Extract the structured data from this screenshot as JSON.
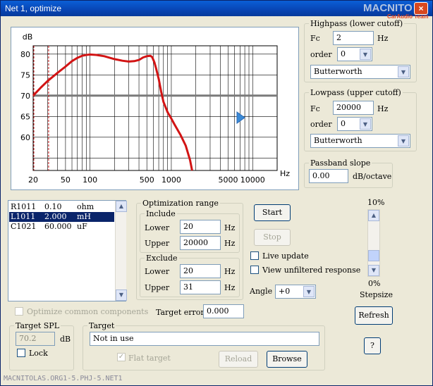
{
  "window": {
    "title": "Net 1, optimize",
    "close_symbol": "×",
    "watermark_brand": "MACNITO",
    "watermark_team": "CarAudio Team"
  },
  "chart_data": {
    "type": "line",
    "ylabel": "dB",
    "xlabel": "Hz",
    "x_scale": "log",
    "xlim": [
      20,
      20000
    ],
    "ylim": [
      52,
      82
    ],
    "y_ticks": [
      80,
      75,
      70,
      65,
      60
    ],
    "x_tick_labels": [
      {
        "v": 20,
        "t": "20"
      },
      {
        "v": 50,
        "t": "50"
      },
      {
        "v": 100,
        "t": "100"
      },
      {
        "v": 500,
        "t": "500"
      },
      {
        "v": 1000,
        "t": "1000"
      },
      {
        "v": 5000,
        "t": "5000"
      },
      {
        "v": 10000,
        "t": "10000"
      }
    ],
    "target_level_db": 70,
    "highpass_marker_hz": 20,
    "lowpass_marker_hz": 31,
    "series": [
      {
        "color": "#d21414",
        "x": [
          20,
          25,
          30,
          40,
          50,
          60,
          70,
          80,
          90,
          100,
          120,
          150,
          200,
          250,
          300,
          350,
          400,
          450,
          500,
          550,
          580,
          620,
          650,
          700,
          750,
          800,
          900,
          1000,
          1100,
          1300,
          1500,
          1700,
          1800
        ],
        "y": [
          70,
          72,
          73.5,
          75.5,
          77,
          78.3,
          79.1,
          79.6,
          79.8,
          79.9,
          79.8,
          79.5,
          78.8,
          78.4,
          78.2,
          78.3,
          78.6,
          79.2,
          79.5,
          79.6,
          79.3,
          78,
          76.5,
          74,
          71,
          68.5,
          66,
          64.5,
          63,
          60.5,
          58,
          54.5,
          52
        ]
      }
    ]
  },
  "highpass": {
    "title": "Highpass (lower cutoff)",
    "fc_label": "Fc",
    "fc_value": "2",
    "fc_unit": "Hz",
    "order_label": "order",
    "order_value": "0",
    "type_value": "Butterworth"
  },
  "lowpass": {
    "title": "Lowpass (upper cutoff)",
    "fc_label": "Fc",
    "fc_value": "20000",
    "fc_unit": "Hz",
    "order_label": "order",
    "order_value": "0",
    "type_value": "Butterworth"
  },
  "passband": {
    "title": "Passband slope",
    "value": "0.00",
    "unit": "dB/octave"
  },
  "components": [
    {
      "name": "R1011",
      "value": "0.10",
      "unit": "ohm",
      "selected": false
    },
    {
      "name": "L1011",
      "value": "2.000",
      "unit": "mH",
      "selected": true
    },
    {
      "name": "C1021",
      "value": "60.000",
      "unit": "uF",
      "selected": false
    }
  ],
  "optimization": {
    "title": "Optimization range",
    "include_title": "Include",
    "include_lower_label": "Lower",
    "include_lower": "20",
    "include_upper_label": "Upper",
    "include_upper": "20000",
    "unit": "Hz",
    "exclude_title": "Exclude",
    "exclude_lower_label": "Lower",
    "exclude_lower": "20",
    "exclude_upper_label": "Upper",
    "exclude_upper": "31"
  },
  "controls": {
    "start": "Start",
    "stop": "Stop",
    "live_update": "Live update",
    "view_unfiltered": "View unfiltered response",
    "angle_label": "Angle",
    "angle_value": "+0",
    "stepsize_top": "10%",
    "stepsize_bottom": "0%",
    "stepsize_label": "Stepsize",
    "stepsize_level": 0.1,
    "refresh": "Refresh",
    "help": "?"
  },
  "bottom": {
    "optimize_common": "Optimize common components",
    "target_error_label": "Target error",
    "target_error_value": "0.000",
    "target_spl_title": "Target SPL",
    "target_spl_value": "70.2",
    "target_spl_unit": "dB",
    "lock_label": "Lock",
    "target_title": "Target",
    "target_value": "Not in use",
    "flat_target": "Flat target",
    "flat_target_checked": true,
    "reload": "Reload",
    "browse": "Browse"
  },
  "status_text": "MACNITOLAS.ORG1-5.PHJ-5.NET1"
}
